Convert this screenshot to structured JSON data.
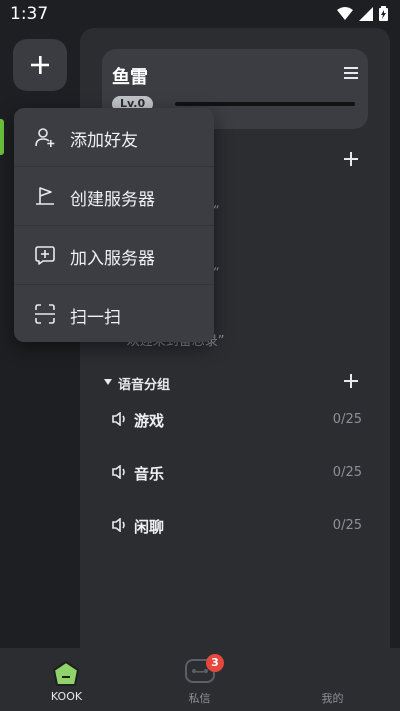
{
  "status_bar": {
    "time": "1:37",
    "icons": [
      "wifi-icon",
      "signal-icon",
      "battery-icon"
    ]
  },
  "server": {
    "name": "鱼雷",
    "level": "Lv.0"
  },
  "ghost_text": [
    "“",
    "“",
    "“欢迎来到备忘录”"
  ],
  "voice_group": {
    "title": "语音分组",
    "channels": [
      {
        "name": "游戏",
        "count": "0/25"
      },
      {
        "name": "音乐",
        "count": "0/25"
      },
      {
        "name": "闲聊",
        "count": "0/25"
      }
    ]
  },
  "popup_menu": [
    {
      "label": "添加好友",
      "icon": "add-friend-icon"
    },
    {
      "label": "创建服务器",
      "icon": "create-server-icon"
    },
    {
      "label": "加入服务器",
      "icon": "join-server-icon"
    },
    {
      "label": "扫一扫",
      "icon": "scan-icon"
    }
  ],
  "bottom_nav": [
    {
      "label": "KOOK",
      "icon": "kook-home-icon",
      "active": true
    },
    {
      "label": "私信",
      "icon": "messages-icon",
      "badge": "3"
    },
    {
      "label": "我的",
      "icon": "profile-icon"
    }
  ],
  "colors": {
    "accent": "#6ac23b",
    "badge": "#e5483f",
    "background": "#1e1f22",
    "panel": "#2b2d31"
  }
}
